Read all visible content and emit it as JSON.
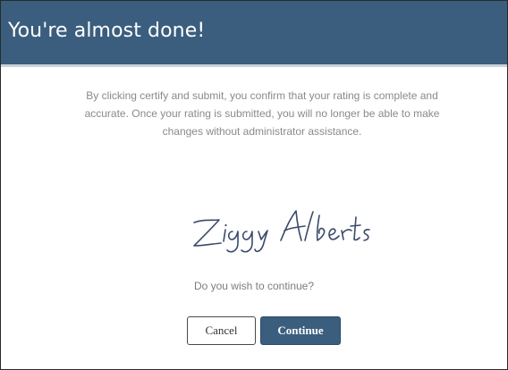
{
  "dialog": {
    "title": "You're almost done!",
    "message": "By clicking certify and submit, you confirm that your rating is complete and accurate. Once your rating is submitted, you will no longer be able to make changes without administrator assistance.",
    "signature": "Ziggy Alberts",
    "question": "Do you wish to continue?",
    "cancel_label": "Cancel",
    "continue_label": "Continue"
  },
  "colors": {
    "header_background": "#3b5e7e",
    "primary_button": "#3b5e7e",
    "body_text": "#8a8a8a",
    "signature_ink": "#3a4a6b"
  }
}
